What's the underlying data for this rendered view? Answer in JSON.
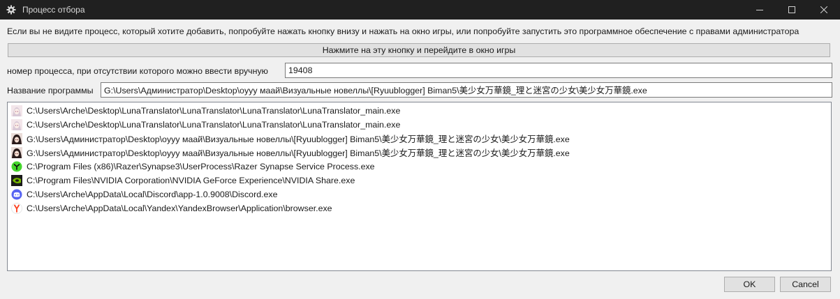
{
  "window": {
    "title": "Процесс отбора",
    "icon": "gear-icon",
    "controls": [
      "minimize-icon",
      "maximize-icon",
      "close-icon"
    ]
  },
  "hint": "Если вы не видите процесс, который хотите добавить, попробуйте нажать кнопку внизу и нажать на окно игры, или попробуйте запустить это программное обеспечение с правами администратора",
  "pick_button": "Нажмите на эту кнопку и перейдите в окно игры",
  "pid": {
    "label": "номер процесса, при отсутствии которого можно ввести вручную",
    "value": "19408"
  },
  "program": {
    "label": "Название программы",
    "value": "G:\\Users\\Администратор\\Desktop\\oyyy маай\\Визуальные новеллы\\[Ryuublogger] Biman5\\美少女万華鏡_理と迷宮の少女\\美少女万華鏡.exe"
  },
  "processes": [
    {
      "icon": "anime-avatar-icon",
      "path": "C:\\Users\\Arche\\Desktop\\LunaTranslator\\LunaTranslator\\LunaTranslator\\LunaTranslator_main.exe"
    },
    {
      "icon": "anime-avatar-icon",
      "path": "C:\\Users\\Arche\\Desktop\\LunaTranslator\\LunaTranslator\\LunaTranslator\\LunaTranslator_main.exe"
    },
    {
      "icon": "game-girl-icon",
      "path": "G:\\Users\\Администратор\\Desktop\\oyyy маай\\Визуальные новеллы\\[Ryuublogger] Biman5\\美少女万華鏡_理と迷宮の少女\\美少女万華鏡.exe"
    },
    {
      "icon": "game-girl-icon",
      "path": "G:\\Users\\Администратор\\Desktop\\oyyy маай\\Визуальные новеллы\\[Ryuublogger] Biman5\\美少女万華鏡_理と迷宮の少女\\美少女万華鏡.exe"
    },
    {
      "icon": "razer-icon",
      "path": "C:\\Program Files (x86)\\Razer\\Synapse3\\UserProcess\\Razer Synapse Service Process.exe"
    },
    {
      "icon": "nvidia-icon",
      "path": "C:\\Program Files\\NVIDIA Corporation\\NVIDIA GeForce Experience\\NVIDIA Share.exe"
    },
    {
      "icon": "discord-icon",
      "path": "C:\\Users\\Arche\\AppData\\Local\\Discord\\app-1.0.9008\\Discord.exe"
    },
    {
      "icon": "yandex-icon",
      "path": "C:\\Users\\Arche\\AppData\\Local\\Yandex\\YandexBrowser\\Application\\browser.exe"
    }
  ],
  "buttons": {
    "ok": "OK",
    "cancel": "Cancel"
  },
  "colors": {
    "titlebar": "#202020",
    "razer": "#44d62c",
    "nvidia": "#76b900",
    "discord": "#5865f2",
    "yandex": "#fc3f1d"
  }
}
